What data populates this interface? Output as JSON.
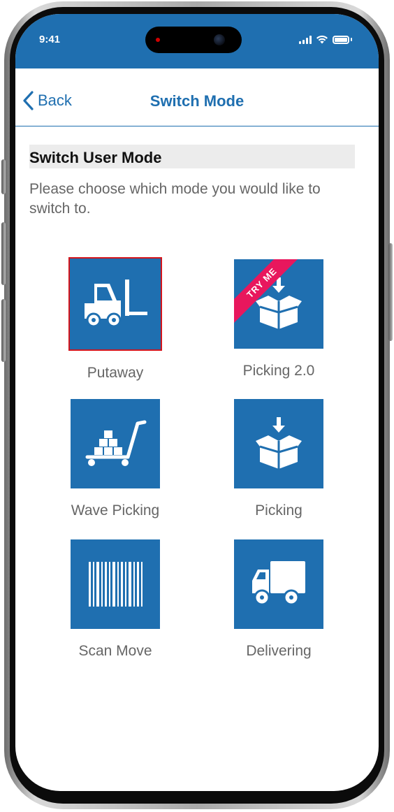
{
  "status_bar": {
    "time": "9:41"
  },
  "nav": {
    "back_label": "Back",
    "title": "Switch Mode"
  },
  "section": {
    "title": "Switch User Mode",
    "instructions": "Please choose which mode you would like to switch to."
  },
  "modes": [
    {
      "label": "Putaway",
      "icon": "forklift-icon",
      "selected": true
    },
    {
      "label": "Picking 2.0",
      "icon": "package-box-icon",
      "badge": "TRY ME"
    },
    {
      "label": "Wave Picking",
      "icon": "cart-boxes-icon"
    },
    {
      "label": "Picking",
      "icon": "package-box-icon"
    },
    {
      "label": "Scan Move",
      "icon": "barcode-icon"
    },
    {
      "label": "Delivering",
      "icon": "truck-icon"
    }
  ],
  "colors": {
    "accent": "#1f6fb0",
    "selected_border": "#d4151c",
    "badge": "#e8175d",
    "section_bg": "#ececec"
  }
}
